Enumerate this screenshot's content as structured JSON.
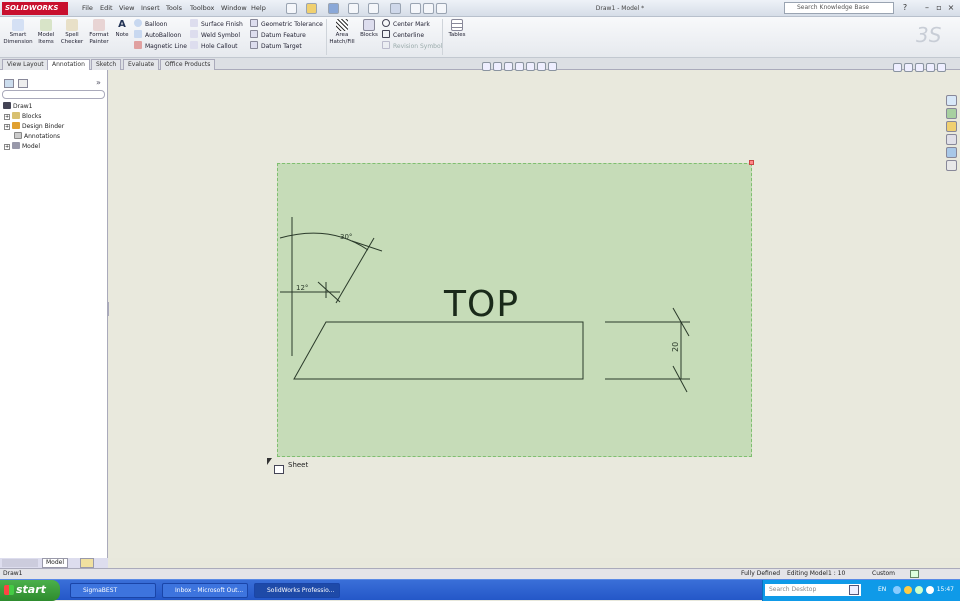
{
  "app": {
    "logo": "SOLIDWORKS",
    "window_title": "Draw1 - Model *"
  },
  "menu": [
    "File",
    "Edit",
    "View",
    "Insert",
    "Tools",
    "Toolbox",
    "Window",
    "Help"
  ],
  "search": {
    "placeholder": "Search Knowledge Base"
  },
  "ribbon": {
    "smart_dimension": "Smart Dimension",
    "model_items": "Model Items",
    "spell_checker": "Spell Checker",
    "format_painter": "Format Painter",
    "note": "Note",
    "balloon": "Balloon",
    "auto_balloon": "AutoBalloon",
    "magnetic_line": "Magnetic Line",
    "surface_finish": "Surface Finish",
    "weld_symbol": "Weld Symbol",
    "hole_callout": "Hole Callout",
    "geometric_tolerance": "Geometric Tolerance",
    "datum_feature": "Datum Feature",
    "datum_target": "Datum Target",
    "area_hatch": "Area Hatch/Fill",
    "blocks": "Blocks",
    "center_mark": "Center Mark",
    "centerline": "Centerline",
    "revision_symbol": "Revision Symbol",
    "tables": "Tables"
  },
  "tabs": [
    "View Layout",
    "Annotation",
    "Sketch",
    "Evaluate",
    "Office Products"
  ],
  "active_tab": "Annotation",
  "tree": {
    "root": "Draw1",
    "items": [
      "Blocks",
      "Design Binder",
      "Annotations",
      "Model"
    ]
  },
  "drawing": {
    "view_label": "TOP",
    "dim_angle_30": "30°",
    "dim_12": "12°",
    "dim_20": "20",
    "sheet_label": "Sheet"
  },
  "bottom_tab": "Model",
  "status": {
    "left": "Draw1",
    "defined": "Fully Defined",
    "editing": "Editing Model",
    "scale": "1 : 10",
    "units": "Custom"
  },
  "taskbar": {
    "start": "start",
    "buttons": [
      "SigmaBEST",
      "Inbox - Microsoft Out...",
      "SolidWorks Professio..."
    ],
    "search": "Search Desktop",
    "lang": "EN",
    "clock": "15:47"
  },
  "colors": {
    "sheet": "#c6dcb8",
    "taskbar": "#2457c8",
    "logo": "#c8102e"
  }
}
